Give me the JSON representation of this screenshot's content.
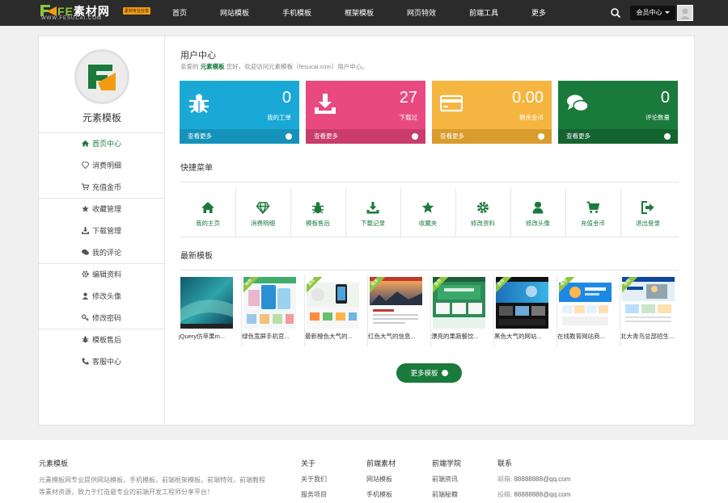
{
  "brand": {
    "logo_prefix": "FE",
    "logo_text": "素材网",
    "badge": "素材专业分享",
    "url": "WWW.FESUCAI.COM"
  },
  "nav": [
    "首页",
    "网站模板",
    "手机模板",
    "框架模板",
    "网页特效",
    "前端工具",
    "更多"
  ],
  "header": {
    "member_label": "会员中心"
  },
  "sidebar": {
    "username": "元素模板",
    "items": [
      {
        "label": "首页中心",
        "icon": "home-icon",
        "active": true
      },
      {
        "label": "消费明细",
        "icon": "diamond-icon"
      },
      {
        "label": "充值金币",
        "icon": "cart-icon"
      },
      {
        "label": "收藏管理",
        "icon": "star-icon"
      },
      {
        "label": "下载管理",
        "icon": "download-icon"
      },
      {
        "label": "我的评论",
        "icon": "comments-icon"
      },
      {
        "label": "编辑资料",
        "icon": "gear-icon"
      },
      {
        "label": "修改头像",
        "icon": "user-icon"
      },
      {
        "label": "修改密码",
        "icon": "key-icon"
      },
      {
        "label": "模板售后",
        "icon": "bug-icon"
      },
      {
        "label": "客服中心",
        "icon": "phone-icon"
      }
    ]
  },
  "main": {
    "title": "用户中心",
    "welcome_pre": "亲爱的",
    "welcome_name": "元素模板",
    "welcome_post": "您好，欢迎访问元素模板（fesucai.com）用户中心。",
    "stats": [
      {
        "value": "0",
        "label": "我的工单",
        "footer": "查看更多",
        "color": "#1aa9d6",
        "footer_color": "#1592b9",
        "icon": "bug-icon"
      },
      {
        "value": "27",
        "label": "下载过",
        "footer": "查看更多",
        "color": "#e84a7f",
        "footer_color": "#c93c6b",
        "icon": "download-icon"
      },
      {
        "value": "0.00",
        "label": "剩余金币",
        "footer": "查看更多",
        "color": "#f5b540",
        "footer_color": "#d99c2d",
        "icon": "credit-card-icon"
      },
      {
        "value": "0",
        "label": "评论数量",
        "footer": "查看更多",
        "color": "#1a7a3c",
        "footer_color": "#146330",
        "icon": "comments-icon"
      }
    ],
    "quick_title": "快捷菜单",
    "quick": [
      {
        "label": "我的主页",
        "icon": "home-icon"
      },
      {
        "label": "消费明细",
        "icon": "diamond-icon"
      },
      {
        "label": "模板售后",
        "icon": "bug-icon"
      },
      {
        "label": "下载记录",
        "icon": "download-icon"
      },
      {
        "label": "收藏夹",
        "icon": "star-icon"
      },
      {
        "label": "修改资料",
        "icon": "gear-icon"
      },
      {
        "label": "修改头像",
        "icon": "user-icon"
      },
      {
        "label": "充值金币",
        "icon": "cart-icon"
      },
      {
        "label": "退出登录",
        "icon": "logout-icon"
      }
    ],
    "latest_title": "最新模板",
    "templates": [
      {
        "name": "jQuery仿苹果m...",
        "ribbon": ""
      },
      {
        "name": "绿色宽屏手机官...",
        "ribbon": "推荐"
      },
      {
        "name": "最新橙色大气的...",
        "ribbon": "推荐"
      },
      {
        "name": "红色大气的信息...",
        "ribbon": "推荐"
      },
      {
        "name": "漂亮的果蔬餐饮...",
        "ribbon": "推荐"
      },
      {
        "name": "黑色大气的网站...",
        "ribbon": "推荐"
      },
      {
        "name": "在线教育网站商...",
        "ribbon": "推荐"
      },
      {
        "name": "北大青鸟总部招生...",
        "ribbon": "推荐"
      }
    ],
    "more_button": "更多模板"
  },
  "footer": {
    "about_title": "元素模板",
    "about_desc": "元素模板网专业提供网站模板，手机模板，前端框架模板，前端特效，前端教程等素材资源，致力于打造最专业的前端开发工程师分享平台！",
    "cols": [
      {
        "title": "关于",
        "links": [
          "关于我们",
          "服务项目"
        ]
      },
      {
        "title": "前端素材",
        "links": [
          "网站模板",
          "手机模板"
        ]
      },
      {
        "title": "前端学院",
        "links": [
          "前端资讯",
          "前端秘籍"
        ]
      }
    ],
    "contact_title": "联系",
    "contacts": [
      {
        "key": "邮箱:",
        "value": "88888888@qq.com"
      },
      {
        "key": "投稿:",
        "value": "88888888@qq.com"
      }
    ]
  },
  "colors": {
    "topbar": "#2b2b2b",
    "accent": "#1a7a3c",
    "ribbon": "#8dc63f"
  }
}
